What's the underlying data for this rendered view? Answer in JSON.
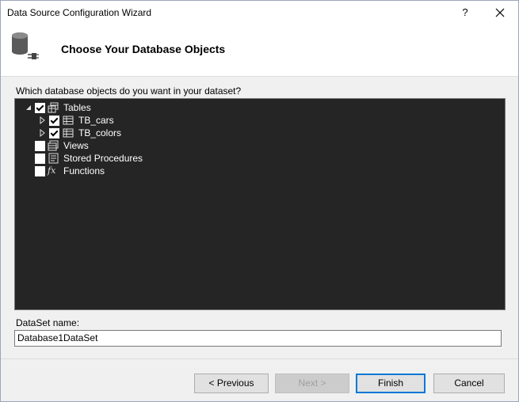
{
  "window": {
    "title": "Data Source Configuration Wizard",
    "help_glyph": "?"
  },
  "header": {
    "title": "Choose Your Database Objects",
    "icon": "database-connection-icon"
  },
  "question": "Which database objects do you want in your dataset?",
  "tree": {
    "tables": {
      "label": "Tables",
      "checked": true,
      "expanded": true
    },
    "table_items": [
      {
        "label": "TB_cars",
        "checked": true,
        "expanded": false
      },
      {
        "label": "TB_colors",
        "checked": true,
        "expanded": false
      }
    ],
    "views": {
      "label": "Views",
      "checked": false
    },
    "stored_procedures": {
      "label": "Stored Procedures",
      "checked": false
    },
    "functions": {
      "label": "Functions",
      "checked": false,
      "icon_glyph": "fx"
    }
  },
  "dataset": {
    "label": "DataSet name:",
    "value": "Database1DataSet"
  },
  "buttons": {
    "previous": "< Previous",
    "next": "Next >",
    "finish": "Finish",
    "cancel": "Cancel"
  }
}
